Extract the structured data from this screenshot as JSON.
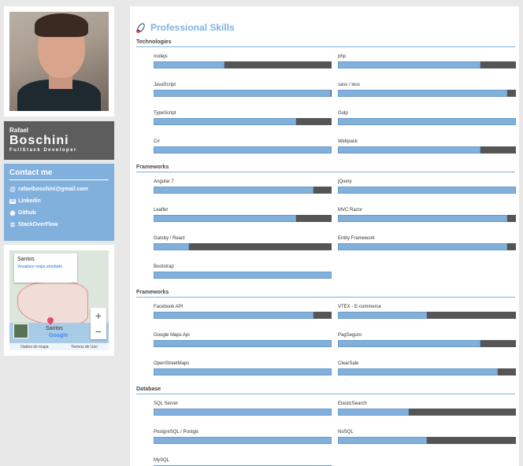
{
  "profile": {
    "first_name": "Rafael",
    "last_name": "Boschini",
    "role": "FullStack Developer"
  },
  "contact": {
    "title": "Contact me",
    "items": [
      {
        "icon": "at-icon",
        "glyph": "@",
        "label": "rafaelboschini@gmail.com"
      },
      {
        "icon": "linkedin-icon",
        "glyph": "in",
        "label": "Linkedin"
      },
      {
        "icon": "github-icon",
        "glyph": "◉",
        "label": "Github"
      },
      {
        "icon": "stackoverflow-icon",
        "glyph": "≣",
        "label": "StackOverFlow"
      }
    ]
  },
  "map": {
    "popup_title": "Santos",
    "popup_link": "Visualizar mapa ampliado",
    "place_label": "Santos",
    "brand": "Google",
    "attribution_data": "Dados do mapa",
    "attribution_terms": "Termos de Uso",
    "zoom_in": "+",
    "zoom_out": "−"
  },
  "main": {
    "title": "Professional Skills",
    "sections": [
      {
        "title": "Technologies",
        "skills": [
          {
            "name": "nodejs",
            "level": 0.4
          },
          {
            "name": "php",
            "level": 0.8
          },
          {
            "name": "JavaScript",
            "level": 0.995
          },
          {
            "name": "sass / less",
            "level": 0.95
          },
          {
            "name": "TypeScript",
            "level": 0.8
          },
          {
            "name": "Gulp",
            "level": 1.0
          },
          {
            "name": "C#",
            "level": 1.0
          },
          {
            "name": "Webpack",
            "level": 0.8
          }
        ]
      },
      {
        "title": "Frameworks",
        "skills": [
          {
            "name": "Angular 7",
            "level": 0.9
          },
          {
            "name": "jQuery",
            "level": 1.0
          },
          {
            "name": "Leaflet",
            "level": 0.8
          },
          {
            "name": "MVC Razor",
            "level": 0.95
          },
          {
            "name": "Gatsby / React",
            "level": 0.2
          },
          {
            "name": "Entity Framework",
            "level": 0.95
          },
          {
            "name": "Bootstrap",
            "level": 1.0
          }
        ]
      },
      {
        "title": "Frameworks",
        "skills": [
          {
            "name": "Facebook API",
            "level": 0.9
          },
          {
            "name": "VTEX - E-commerce",
            "level": 0.5
          },
          {
            "name": "Google Maps Api",
            "level": 1.0
          },
          {
            "name": "PagSeguro",
            "level": 0.8
          },
          {
            "name": "OpenStreetMaps",
            "level": 1.0
          },
          {
            "name": "ClearSale",
            "level": 0.9
          }
        ]
      },
      {
        "title": "Database",
        "skills": [
          {
            "name": "SQL Server",
            "level": 1.0
          },
          {
            "name": "ElasticSearch",
            "level": 0.4
          },
          {
            "name": "PostgreSQL / Postgis",
            "level": 1.0
          },
          {
            "name": "NoSQL",
            "level": 0.5
          },
          {
            "name": "MySQL",
            "level": 1.0
          }
        ]
      }
    ]
  },
  "colors": {
    "accent": "#82b0dd",
    "dark": "#5d5d5d",
    "bar_track": "#555555"
  }
}
